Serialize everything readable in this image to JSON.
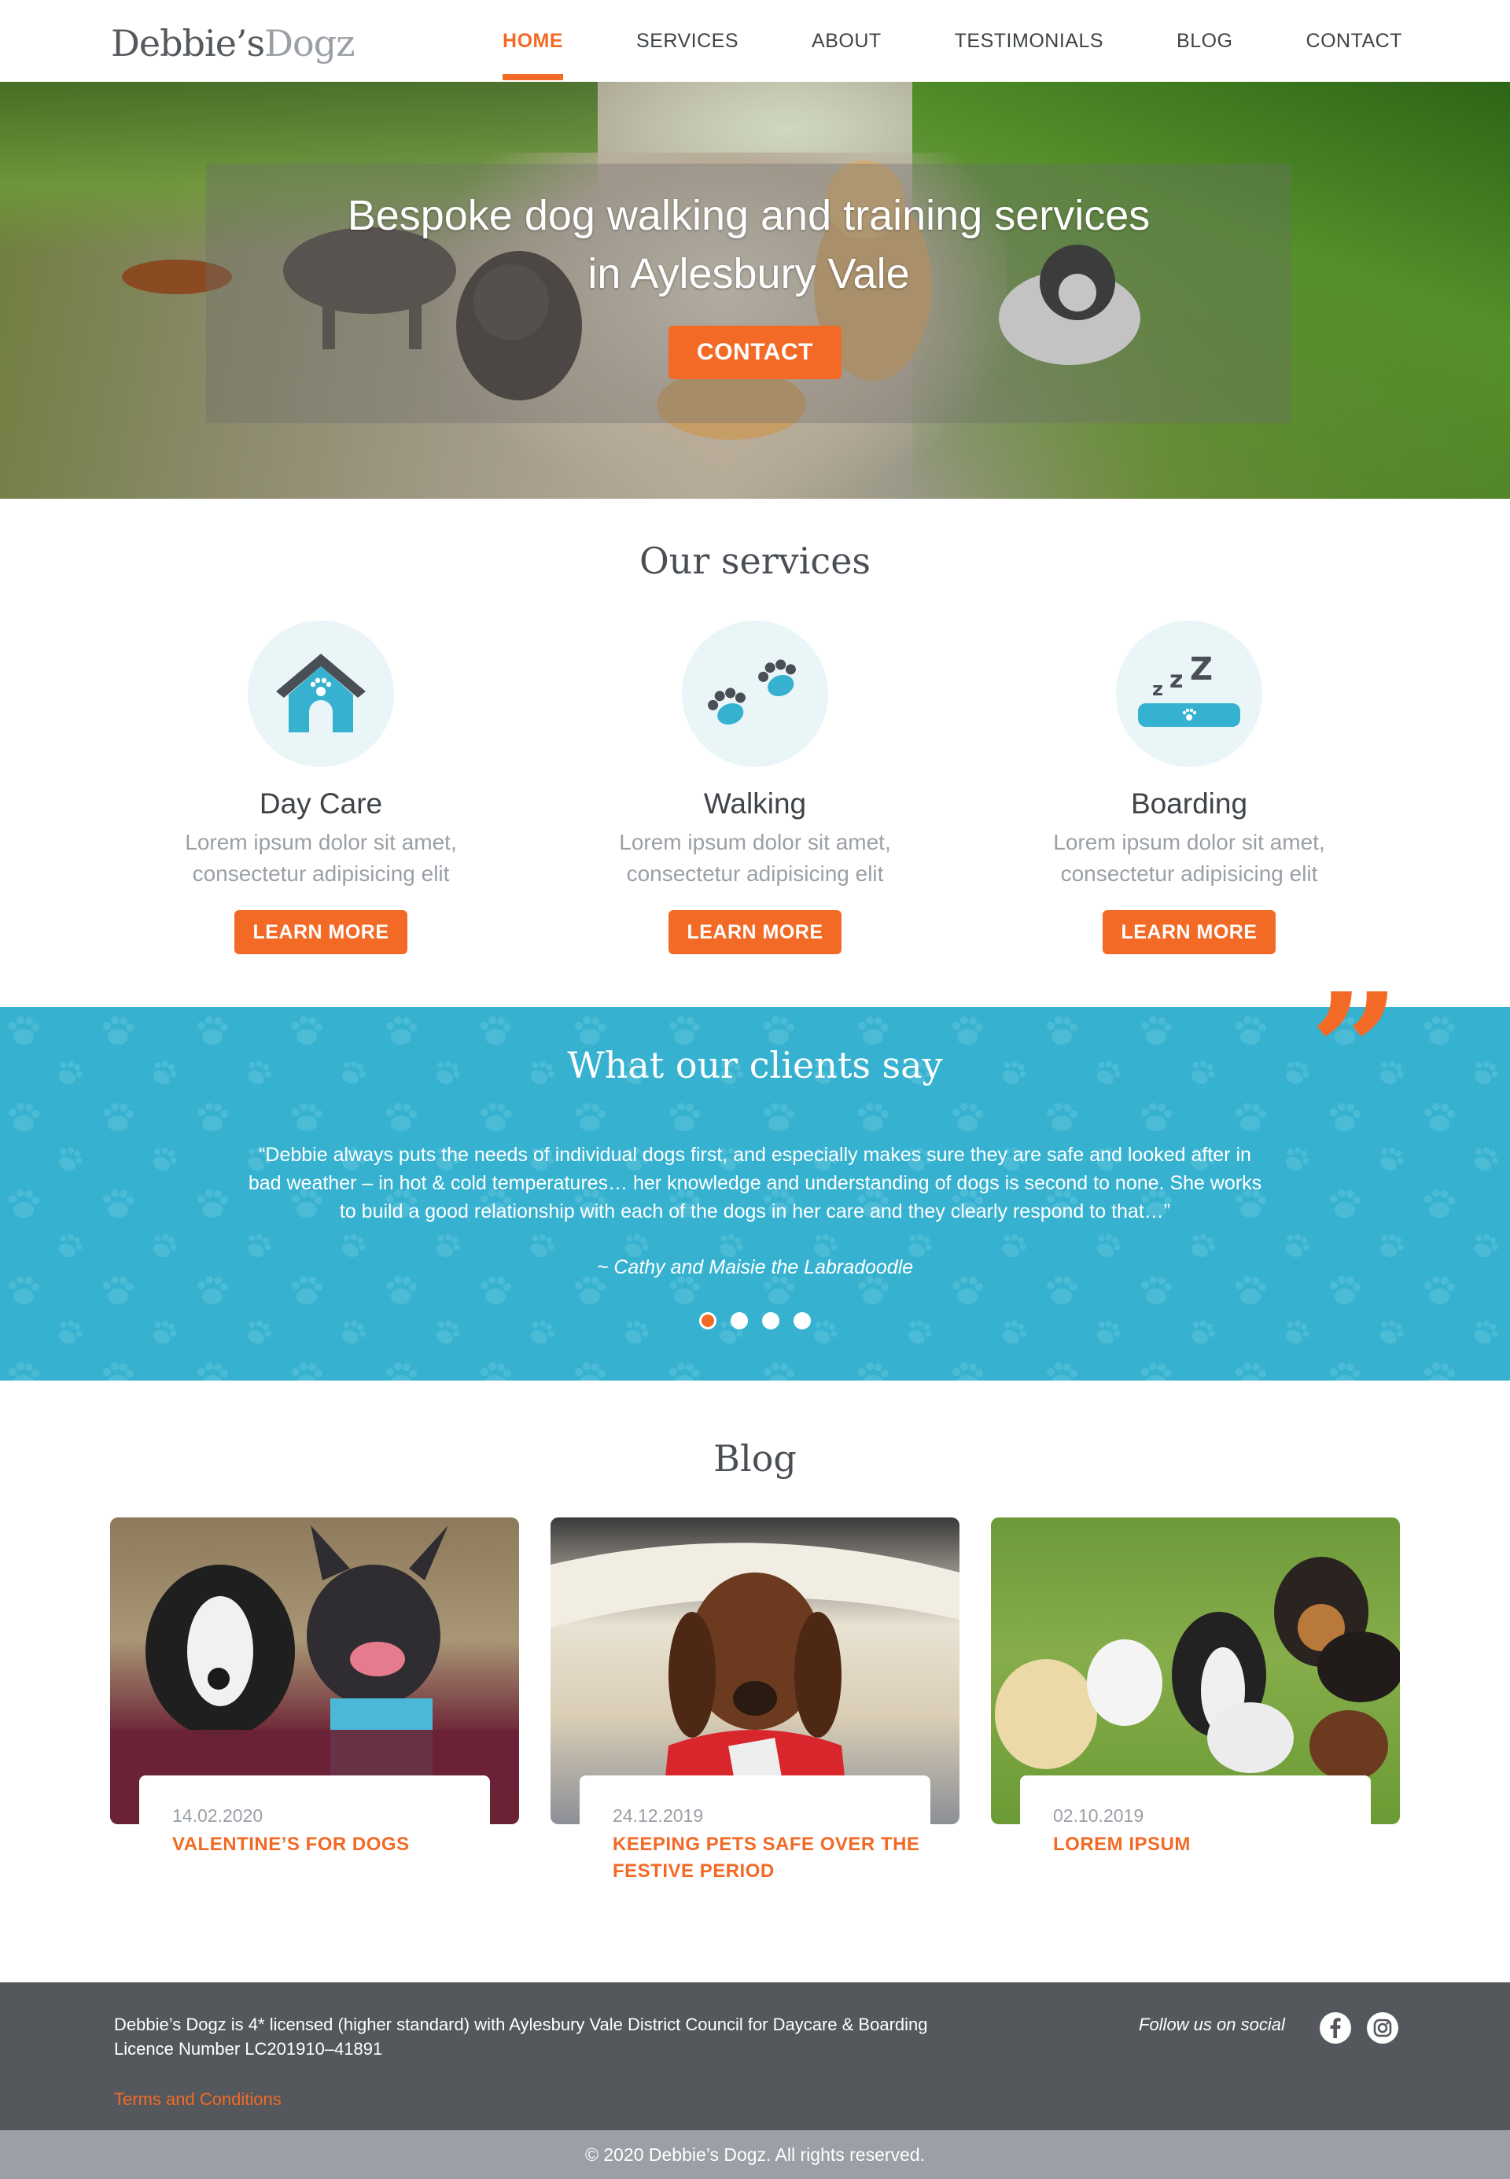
{
  "brand": {
    "logo_part1": "Debbie’s",
    "logo_part2": "Dogz"
  },
  "nav": {
    "items": [
      {
        "label": "HOME",
        "active": true
      },
      {
        "label": "SERVICES",
        "active": false
      },
      {
        "label": "ABOUT",
        "active": false
      },
      {
        "label": "TESTIMONIALS",
        "active": false
      },
      {
        "label": "BLOG",
        "active": false
      },
      {
        "label": "CONTACT",
        "active": false
      }
    ]
  },
  "hero": {
    "title_line1": "Bespoke dog walking and training services",
    "title_line2": "in Aylesbury Vale",
    "cta_label": "CONTACT"
  },
  "services": {
    "title": "Our services",
    "items": [
      {
        "name": "Day Care",
        "desc_line1": "Lorem ipsum dolor sit amet,",
        "desc_line2": "consectetur adipisicing elit",
        "button": "LEARN MORE",
        "icon": "dog-house-icon"
      },
      {
        "name": "Walking",
        "desc_line1": "Lorem ipsum dolor sit amet,",
        "desc_line2": "consectetur adipisicing elit",
        "button": "LEARN MORE",
        "icon": "paw-prints-icon"
      },
      {
        "name": "Boarding",
        "desc_line1": "Lorem ipsum dolor sit amet,",
        "desc_line2": "consectetur adipisicing elit",
        "button": "LEARN MORE",
        "icon": "dog-bed-sleep-icon"
      }
    ]
  },
  "testimonials": {
    "title": "What our clients say",
    "quote_line1": "“Debbie always puts the needs of individual dogs first, and especially makes sure they are safe and looked after in",
    "quote_line2": "bad weather – in hot & cold temperatures… her knowledge and understanding of dogs is second to none.  She works",
    "quote_line3": "to build a good relationship with each of the dogs in her care and they clearly respond to that…”",
    "author": "~ Cathy and Maisie the Labradoodle",
    "active_dot": 0,
    "dot_count": 4
  },
  "blog": {
    "title": "Blog",
    "posts": [
      {
        "date": "14.02.2020",
        "title_line1": "VALENTINE’S FOR DOGS",
        "title_line2": ""
      },
      {
        "date": "24.12.2019",
        "title_line1": "KEEPING PETS SAFE OVER THE",
        "title_line2": "FESTIVE PERIOD"
      },
      {
        "date": "02.10.2019",
        "title_line1": "LOREM IPSUM",
        "title_line2": ""
      }
    ]
  },
  "footer": {
    "license_line1": "Debbie’s Dogz is 4* licensed (higher standard) with Aylesbury Vale District Council for Daycare & Boarding",
    "license_line2": "Licence Number LC201910–41891",
    "terms": "Terms and Conditions",
    "follow": "Follow us on social",
    "social": [
      "facebook-icon",
      "instagram-icon"
    ],
    "copyright": "© 2020 Debbie’s Dogz. All rights reserved."
  },
  "colors": {
    "accent": "#f26a25",
    "teal": "#36b2d0",
    "dark": "#54585d",
    "text": "#4a4f55"
  }
}
